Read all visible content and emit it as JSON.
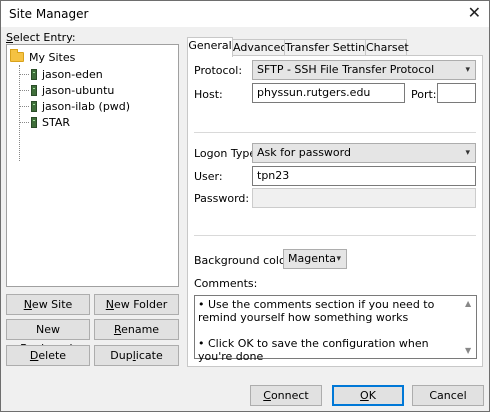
{
  "window": {
    "title": "Site Manager",
    "close_glyph": "✕"
  },
  "left": {
    "select_entry_prefix": "S",
    "select_entry_rest": "elect Entry:",
    "tree": {
      "root": "My Sites",
      "items": [
        "jason-eden",
        "jason-ubuntu",
        "jason-ilab (pwd)",
        "STAR"
      ]
    },
    "buttons": {
      "new_site": {
        "m": "N",
        "rest": "ew Site"
      },
      "new_folder": {
        "m": "N",
        "rest": "ew Folder",
        "pre": ""
      },
      "new_bookmark": {
        "pre": "New Book",
        "m": "m",
        "rest": "ark"
      },
      "rename": {
        "m": "R",
        "rest": "ename"
      },
      "delete": {
        "m": "D",
        "rest": "elete"
      },
      "duplicate": {
        "pre": "Dup",
        "m": "l",
        "rest": "icate"
      }
    }
  },
  "tabs": [
    "General",
    "Advanced",
    "Transfer Settings",
    "Charset"
  ],
  "general": {
    "protocol_label": "Protocol:",
    "protocol_value": "SFTP - SSH File Transfer Protocol",
    "host_label": "Host:",
    "host_value": "physsun.rutgers.edu",
    "port_label": "Port:",
    "port_value": "",
    "logon_type_label": "Logon Type:",
    "logon_type_value": "Ask for password",
    "user_label": "User:",
    "user_value": "tpn23",
    "password_label": "Password:",
    "password_value": "",
    "bg_color_label": "Background color:",
    "bg_color_value": "Magenta",
    "comments_label": "Comments:",
    "comments": [
      "• Use the comments section if you need to remind yourself how something works",
      "• Click OK to save the configuration when you're done"
    ]
  },
  "footer": {
    "connect": {
      "m": "C",
      "rest": "onnect"
    },
    "ok": {
      "m": "O",
      "rest": "K"
    },
    "cancel": "Cancel"
  },
  "icons": {
    "dropdown": "▾",
    "scroll_up": "▲",
    "scroll_down": "▼"
  }
}
